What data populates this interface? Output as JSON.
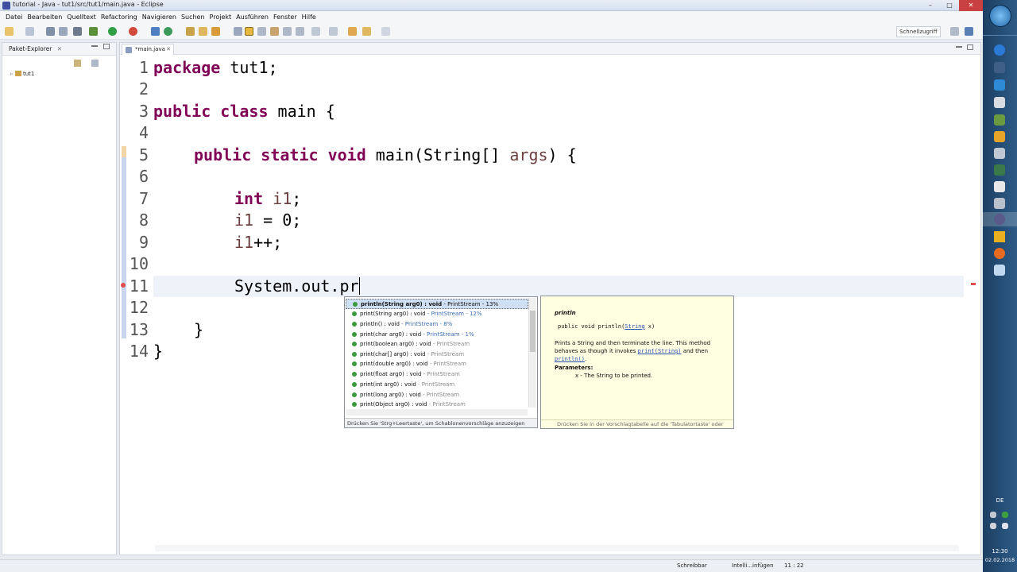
{
  "window": {
    "title": "tutorial - Java - tut1/src/tut1/main.java - Eclipse",
    "buttons": [
      "–",
      "□",
      "✕"
    ]
  },
  "menu": [
    "Datei",
    "Bearbeiten",
    "Quelltext",
    "Refactoring",
    "Navigieren",
    "Suchen",
    "Projekt",
    "Ausführen",
    "Fenster",
    "Hilfe"
  ],
  "toolbar": {
    "quick_access": "Schnellzugriff"
  },
  "package_explorer": {
    "title": "Paket-Explorer",
    "close": "✕",
    "tree": [
      {
        "label": "tut1"
      }
    ]
  },
  "editor": {
    "tab_label": "*main.java",
    "tab_close": "✕",
    "lines": [
      {
        "num": "1"
      },
      {
        "num": "2"
      },
      {
        "num": "3"
      },
      {
        "num": "4"
      },
      {
        "num": "5"
      },
      {
        "num": "6"
      },
      {
        "num": "7"
      },
      {
        "num": "8"
      },
      {
        "num": "9"
      },
      {
        "num": "10"
      },
      {
        "num": "11"
      },
      {
        "num": "12"
      },
      {
        "num": "13"
      },
      {
        "num": "14"
      }
    ],
    "code": {
      "l1_kw": "package",
      "l1_rest": " tut1;",
      "l3_kw": "public class",
      "l3_rest": " main {",
      "l5_kw": "public static void",
      "l5_rest1": " main(String[] ",
      "l5_var": "args",
      "l5_rest2": ") {",
      "l7_kw": "int",
      "l7_var": " i1",
      "l7_rest": ";",
      "l8_var": "i1",
      "l8_rest": " = 0;",
      "l9_var": "i1",
      "l9_rest": "++;",
      "l11_text": "System.out.pr",
      "l13_text": "}",
      "l14_text": "}"
    }
  },
  "autocomplete": {
    "items": [
      {
        "sig": "println(String arg0) : void",
        "type": " - PrintStream - 13%",
        "selected": true
      },
      {
        "sig": "print(String arg0) : void",
        "type": " - PrintStream - 12%"
      },
      {
        "sig": "println() : void",
        "type": " - PrintStream - 8%"
      },
      {
        "sig": "print(char arg0) : void",
        "type": " - PrintStream - 1%"
      },
      {
        "sig": "print(boolean arg0) : void",
        "type": " - PrintStream"
      },
      {
        "sig": "print(char[] arg0) : void",
        "type": " - PrintStream"
      },
      {
        "sig": "print(double arg0) : void",
        "type": " - PrintStream"
      },
      {
        "sig": "print(float arg0) : void",
        "type": " - PrintStream"
      },
      {
        "sig": "print(int arg0) : void",
        "type": " - PrintStream"
      },
      {
        "sig": "print(long arg0) : void",
        "type": " - PrintStream"
      },
      {
        "sig": "print(Object arg0) : void",
        "type": " - PrintStream"
      }
    ],
    "footer": "Drücken Sie 'Strg+Leertaste', um Schablonenvorschläge anzuzeigen"
  },
  "javadoc": {
    "title": "println",
    "signature_prefix": "public void println(",
    "signature_type": "String",
    "signature_suffix": " x)",
    "desc_1": "Prints a String and then terminate the line. This method behaves as though it invokes ",
    "link_1": "print(String)",
    "desc_2": " and then ",
    "link_2": "println()",
    "desc_3": ".",
    "params_label": "Parameters:",
    "param_text": "x - The String to be printed.",
    "footer": "Drücken Sie in der Vorschlagtabelle auf die 'Tabulatortaste' oder"
  },
  "status": {
    "writable": "Schreibbar",
    "insert_mode": "Intelli...infügen",
    "position": "11 : 22"
  },
  "taskbar": {
    "lang": "DE",
    "time": "12:30",
    "date": "02.02.2018"
  },
  "colors": {
    "keyword": "#7f0055",
    "variable": "#6a3e3e",
    "current_line": "#eef2f9",
    "selection": "#cfe0f5",
    "javadoc_bg": "#ffffe1"
  }
}
